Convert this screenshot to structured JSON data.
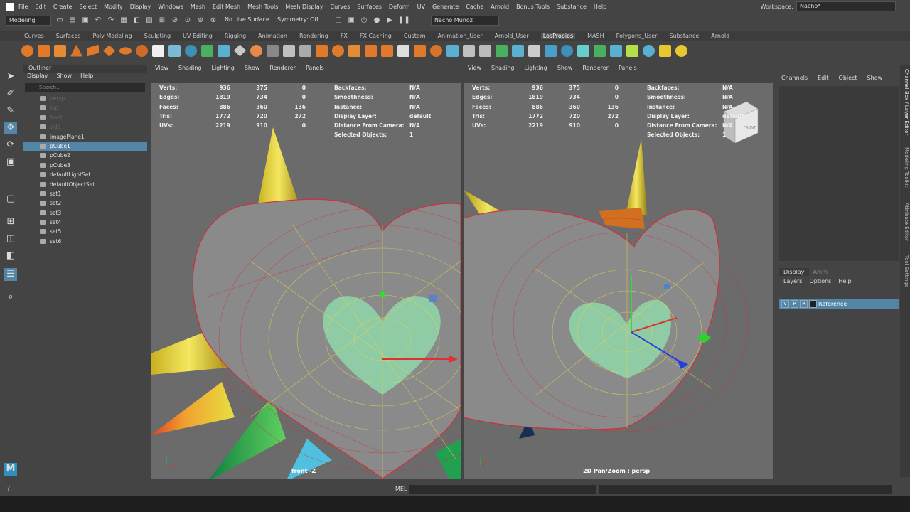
{
  "menubar": {
    "items": [
      "File",
      "Edit",
      "Create",
      "Select",
      "Modify",
      "Display",
      "Windows",
      "Mesh",
      "Edit Mesh",
      "Mesh Tools",
      "Mesh Display",
      "Curves",
      "Surfaces",
      "Deform",
      "UV",
      "Generate",
      "Cache",
      "Arnold",
      "Bonus Tools",
      "Substance",
      "Help"
    ],
    "workspace_label": "Workspace:",
    "workspace_value": "Nacho*"
  },
  "statusline": {
    "mode": "Modeling",
    "live_surface": "No Live Surface",
    "symmetry": "Symmetry: Off",
    "user": "Nacho Muñoz"
  },
  "shelf_tabs": [
    "Curves",
    "Surfaces",
    "Poly Modeling",
    "Sculpting",
    "UV Editing",
    "Rigging",
    "Animation",
    "Rendering",
    "FX",
    "FX Caching",
    "Custom",
    "Animation_User",
    "Arnold_User",
    "LosPropios",
    "MASH",
    "Polygons_User",
    "Substance",
    "Arnold"
  ],
  "shelf_active": "LosPropios",
  "outliner": {
    "title": "Outliner",
    "menu": [
      "Display",
      "Show",
      "Help"
    ],
    "search_placeholder": "Search...",
    "items": [
      {
        "label": "persp",
        "dim": true,
        "sel": false
      },
      {
        "label": "top",
        "dim": true,
        "sel": false
      },
      {
        "label": "front",
        "dim": true,
        "sel": false
      },
      {
        "label": "side",
        "dim": true,
        "sel": false
      },
      {
        "label": "imagePlane1",
        "dim": false,
        "sel": false
      },
      {
        "label": "pCube1",
        "dim": false,
        "sel": true
      },
      {
        "label": "pCube2",
        "dim": false,
        "sel": false
      },
      {
        "label": "pCube3",
        "dim": false,
        "sel": false
      },
      {
        "label": "defaultLightSet",
        "dim": false,
        "sel": false
      },
      {
        "label": "defaultObjectSet",
        "dim": false,
        "sel": false
      },
      {
        "label": "set1",
        "dim": false,
        "sel": false
      },
      {
        "label": "set2",
        "dim": false,
        "sel": false
      },
      {
        "label": "set3",
        "dim": false,
        "sel": false
      },
      {
        "label": "set4",
        "dim": false,
        "sel": false
      },
      {
        "label": "set5",
        "dim": false,
        "sel": false
      },
      {
        "label": "set6",
        "dim": false,
        "sel": false
      }
    ]
  },
  "viewport_menu": [
    "View",
    "Shading",
    "Lighting",
    "Show",
    "Renderer",
    "Panels"
  ],
  "hud_stats": [
    {
      "label": "Verts:",
      "v1": "936",
      "v2": "375",
      "v3": "0"
    },
    {
      "label": "Edges:",
      "v1": "1819",
      "v2": "734",
      "v3": "0"
    },
    {
      "label": "Faces:",
      "v1": "886",
      "v2": "360",
      "v3": "136"
    },
    {
      "label": "Tris:",
      "v1": "1772",
      "v2": "720",
      "v3": "272"
    },
    {
      "label": "UVs:",
      "v1": "2219",
      "v2": "910",
      "v3": "0"
    }
  ],
  "hud_info": [
    {
      "label": "Backfaces:",
      "value": "N/A"
    },
    {
      "label": "Smoothness:",
      "value": "N/A"
    },
    {
      "label": "Instance:",
      "value": "N/A"
    },
    {
      "label": "Display Layer:",
      "value": "default"
    },
    {
      "label": "Distance From Camera:",
      "value": "N/A"
    },
    {
      "label": "Selected Objects:",
      "value": "1"
    }
  ],
  "viewports": {
    "left_camera": "front -Z",
    "right_camera": "2D Pan/Zoom : persp",
    "view_cube_label": "FRONT"
  },
  "channelbox": {
    "menu": [
      "Channels",
      "Edit",
      "Object",
      "Show"
    ],
    "layer_tabs": [
      "Display",
      "Anim"
    ],
    "layer_menu": [
      "Layers",
      "Options",
      "Help"
    ],
    "layer": {
      "v": "V",
      "p": "P",
      "r": "R",
      "name": "Reference"
    }
  },
  "right_tabs": [
    "Channel Box / Layer Editor",
    "Modeling Toolkit",
    "Attribute Editor",
    "Tool Settings"
  ],
  "cmdline": {
    "label": "MEL"
  },
  "colors": {
    "selection": "#5285a6",
    "viewport_bg": "#6b6b6b",
    "mesh_wire_red": "#d0303a",
    "mesh_wire_yellow": "#e8d84a",
    "selection_fill": "#8fd6a8"
  }
}
